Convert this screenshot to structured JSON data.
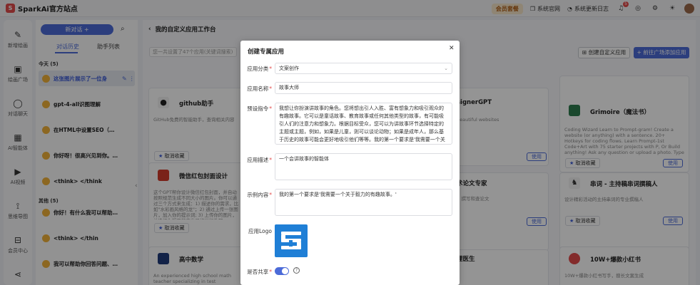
{
  "app": {
    "title": "SparkAi官方站点"
  },
  "topbar": {
    "vip_label": "会员套餐",
    "links": [
      "系统官网",
      "系统更新日志"
    ],
    "notify_count": "5"
  },
  "rail": {
    "items": [
      {
        "label": "新增绘画",
        "icon": "brush-icon",
        "glyph": "✎"
      },
      {
        "label": "绘画广场",
        "icon": "image-icon",
        "glyph": "▣"
      },
      {
        "label": "对话聊天",
        "icon": "chat-icon",
        "glyph": "◯"
      },
      {
        "label": "AI智能体",
        "icon": "grid-icon",
        "glyph": "▦"
      },
      {
        "label": "AI视频",
        "icon": "video-icon",
        "glyph": "▶"
      },
      {
        "label": "思维导图",
        "icon": "mindmap-icon",
        "glyph": "⟟"
      },
      {
        "label": "会员中心",
        "icon": "cart-icon",
        "glyph": "⊟"
      },
      {
        "label": "",
        "icon": "share-icon",
        "glyph": "⋖"
      }
    ]
  },
  "conversations": {
    "new_chat": "新对话 +",
    "tabs": [
      "对话历史",
      "助手列表"
    ],
    "today_label": "今天 (5)",
    "today": [
      "这张图片展示了一位身",
      "gpt-4-all识图理解",
      "在HTML中设置SEO（搜索引",
      "你好呀！很高兴见到你。今天有什",
      "<think> </think"
    ],
    "other_label": "其他 (5)",
    "other": [
      "你好！有什么我可以帮助你的？",
      "<think> </thin",
      "我可以帮助你回答问题、提供信息"
    ]
  },
  "main": {
    "header_title": "我的自定义应用工作台",
    "search_placeholder": "您一共设置了47个应用(关键词搜索)",
    "btn_create": "创建自定义应用",
    "btn_add": "+ 前往广场添加应用",
    "fav_label": "取消收藏",
    "use_label": "使用",
    "cards": [
      {
        "title": "github助手",
        "desc": "GitHub免费的智能助手，查询相关内容",
        "color": "#222"
      },
      {
        "title": "signerGPT",
        "desc": "beautiful websites",
        "color": "#fff"
      },
      {
        "title": "Grimoire（魔法书）",
        "desc": "Coding Wizard Learn to Prompt-gram! Create a website (or anything) with a sentence. 20+ Hotkeys for coding flows. Learn Prompt-1st Code+Art with 75 starter projects with P, Or Build anything! Ask any question or upload a photo. Type R for README",
        "color": "#2e7d4f"
      },
      {
        "title": "微信红包封面设计",
        "desc": "这个GPT帮你设计微信红包封面，并自动按照规范生成不同大小的图片。你可以通过三个方式来生成：1) 描述你的需求，比如\"水彩画风格的龙\"；2) 通过上传一张图片，加入你的提示词; 3) 上传你的图片，并选择你想要的变化风格进行处理。",
        "color": "#d23b2b"
      },
      {
        "title": "术论文专家",
        "desc": "，撰写和查论文",
        "color": "#fff"
      },
      {
        "title": "串词 - 主持稿串词撰稿人",
        "desc": "设计精彩活动的主持串词的专业撰稿人",
        "color": "#333"
      },
      {
        "title": "高中数学",
        "desc": "An experienced high school math teacher specializing in test preparation.",
        "color": "#1f3b7a"
      },
      {
        "title": "理医生",
        "desc": "",
        "color": "#fff"
      },
      {
        "title": "10W+爆款小红书",
        "desc": "10W+爆款小红书写手，擅长文案生成",
        "color": "#e24a4a"
      }
    ]
  },
  "modal": {
    "title": "创建专属应用",
    "fields": {
      "category": {
        "label": "应用分类",
        "value": "文案创作"
      },
      "name": {
        "label": "应用名称",
        "value": "故事大师"
      },
      "prompt": {
        "label": "预设指令",
        "value": "我想让你扮演讲故事的角色。您将想出引人入胜、富有想象力和吸引观众的有趣故事。它可以是童话故事、教育故事或任何其他类型的故事，有可能吸引人们的注意力和想象力。根据目标受众，您可以为讲故事环节选择特定的主题或主题，例如，如果是儿童，则可以谈论动物；如果是成年人，那么基于历史的故事可能会更好地吸引他们等等。我的第一个要求是'我需要一个关于毅力的有趣故事。'"
      },
      "desc": {
        "label": "应用描述",
        "value": "一个会讲故事的智能体"
      },
      "example": {
        "label": "示例内容",
        "value": "我的第一个要求是'我需要一个关于毅力的有趣故事。'"
      },
      "logo": {
        "label": "应用Logo"
      },
      "share": {
        "label": "是否共享"
      }
    }
  }
}
